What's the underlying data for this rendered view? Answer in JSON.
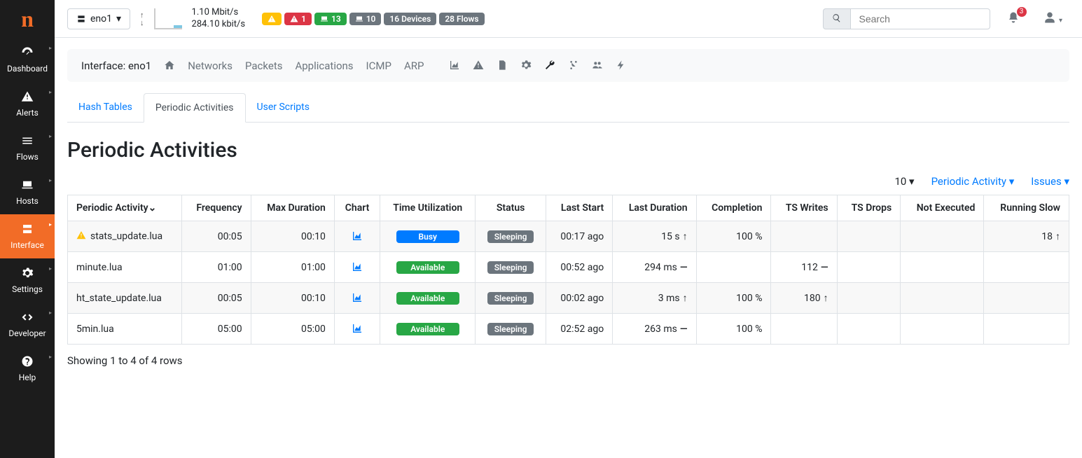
{
  "logo": "n",
  "sidebar": [
    {
      "name": "dashboard",
      "label": "Dashboard",
      "icon": "dashboard",
      "active": false
    },
    {
      "name": "alerts",
      "label": "Alerts",
      "icon": "warning",
      "active": false
    },
    {
      "name": "flows",
      "label": "Flows",
      "icon": "flows",
      "active": false
    },
    {
      "name": "hosts",
      "label": "Hosts",
      "icon": "laptop",
      "active": false
    },
    {
      "name": "interface",
      "label": "Interface",
      "icon": "network",
      "active": true
    },
    {
      "name": "settings",
      "label": "Settings",
      "icon": "gear",
      "active": false
    },
    {
      "name": "developer",
      "label": "Developer",
      "icon": "code",
      "active": false
    },
    {
      "name": "help",
      "label": "Help",
      "icon": "help",
      "active": false
    }
  ],
  "topbar": {
    "interface_selected": "eno1",
    "speed_up": "1.10 Mbit/s",
    "speed_down": "284.10 kbit/s",
    "badges": [
      {
        "name": "warn",
        "text": "",
        "icon": "warning",
        "cls": "badge-yellow"
      },
      {
        "name": "alert",
        "text": "1",
        "icon": "warning",
        "cls": "badge-red"
      },
      {
        "name": "hosts-green",
        "text": "13",
        "icon": "laptop",
        "cls": "badge-green"
      },
      {
        "name": "hosts-grey",
        "text": "10",
        "icon": "laptop",
        "cls": "badge-grey"
      },
      {
        "name": "devices",
        "text": "16 Devices",
        "icon": "",
        "cls": "badge-grey"
      },
      {
        "name": "flows",
        "text": "28 Flows",
        "icon": "",
        "cls": "badge-grey"
      }
    ],
    "search_placeholder": "Search",
    "notif_count": "3"
  },
  "breadcrumb": {
    "prefix": "Interface: eno1",
    "links": [
      "Networks",
      "Packets",
      "Applications",
      "ICMP",
      "ARP"
    ]
  },
  "tabs": [
    {
      "label": "Hash Tables",
      "active": false
    },
    {
      "label": "Periodic Activities",
      "active": true
    },
    {
      "label": "User Scripts",
      "active": false
    }
  ],
  "page_title": "Periodic Activities",
  "controls": {
    "page_size": "10",
    "filter1": "Periodic Activity",
    "filter2": "Issues"
  },
  "table": {
    "headers": [
      "Periodic Activity",
      "Frequency",
      "Max Duration",
      "Chart",
      "Time Utilization",
      "Status",
      "Last Start",
      "Last Duration",
      "Completion",
      "TS Writes",
      "TS Drops",
      "Not Executed",
      "Running Slow"
    ],
    "rows": [
      {
        "warn": true,
        "name": "stats_update.lua",
        "frequency": "00:05",
        "max_duration": "00:10",
        "util": {
          "label": "Busy",
          "cls": "pill-blue"
        },
        "status": "Sleeping",
        "last_start": "00:17 ago",
        "last_duration": "15 s",
        "last_duration_dir": "↑",
        "completion": "100 %",
        "ts_writes": "",
        "ts_writes_dir": "",
        "ts_drops": "",
        "not_executed": "",
        "running_slow": "18",
        "running_slow_dir": "↑"
      },
      {
        "warn": false,
        "name": "minute.lua",
        "frequency": "01:00",
        "max_duration": "01:00",
        "util": {
          "label": "Available",
          "cls": "pill-green"
        },
        "status": "Sleeping",
        "last_start": "00:52 ago",
        "last_duration": "294 ms",
        "last_duration_dir": "—",
        "completion": "",
        "ts_writes": "112",
        "ts_writes_dir": "—",
        "ts_drops": "",
        "not_executed": "",
        "running_slow": "",
        "running_slow_dir": ""
      },
      {
        "warn": false,
        "name": "ht_state_update.lua",
        "frequency": "00:05",
        "max_duration": "00:10",
        "util": {
          "label": "Available",
          "cls": "pill-green"
        },
        "status": "Sleeping",
        "last_start": "00:02 ago",
        "last_duration": "3 ms",
        "last_duration_dir": "↑",
        "completion": "100 %",
        "ts_writes": "180",
        "ts_writes_dir": "↑",
        "ts_drops": "",
        "not_executed": "",
        "running_slow": "",
        "running_slow_dir": ""
      },
      {
        "warn": false,
        "name": "5min.lua",
        "frequency": "05:00",
        "max_duration": "05:00",
        "util": {
          "label": "Available",
          "cls": "pill-green"
        },
        "status": "Sleeping",
        "last_start": "02:52 ago",
        "last_duration": "263 ms",
        "last_duration_dir": "—",
        "completion": "100 %",
        "ts_writes": "",
        "ts_writes_dir": "",
        "ts_drops": "",
        "not_executed": "",
        "running_slow": "",
        "running_slow_dir": ""
      }
    ]
  },
  "footer": "Showing 1 to 4 of 4 rows"
}
